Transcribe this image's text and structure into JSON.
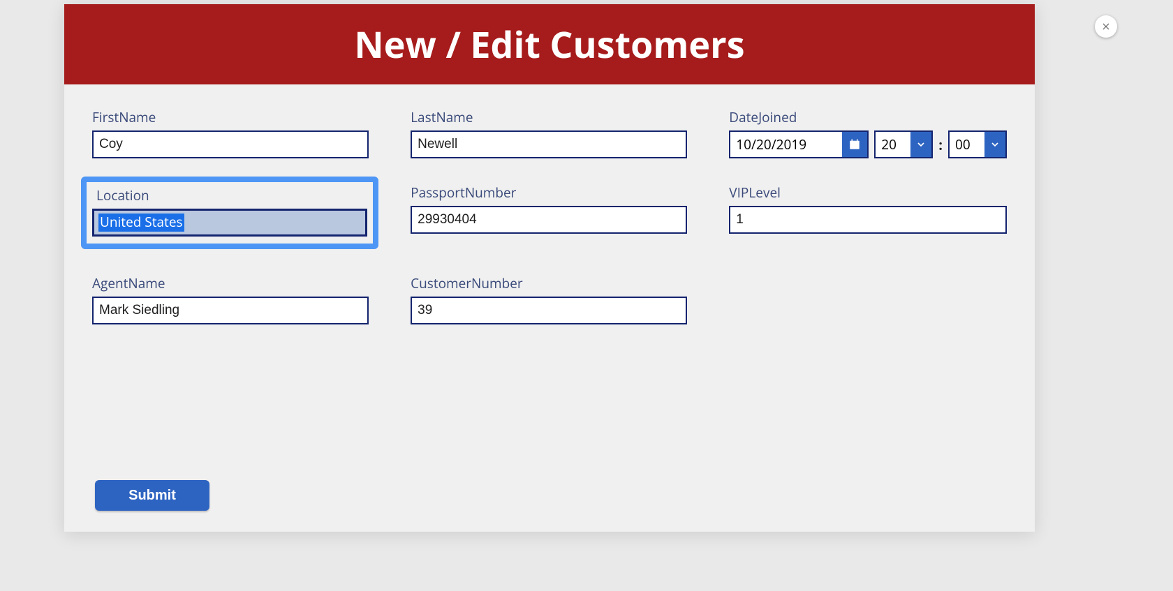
{
  "banner": {
    "title": "New / Edit Customers"
  },
  "fields": {
    "firstName": {
      "label": "FirstName",
      "value": "Coy"
    },
    "lastName": {
      "label": "LastName",
      "value": "Newell"
    },
    "dateJoined": {
      "label": "DateJoined",
      "date": "10/20/2019",
      "hour": "20",
      "minute": "00",
      "sep": ":"
    },
    "location": {
      "label": "Location",
      "value": "United States"
    },
    "passportNumber": {
      "label": "PassportNumber",
      "value": "29930404"
    },
    "vipLevel": {
      "label": "VIPLevel",
      "value": "1"
    },
    "agentName": {
      "label": "AgentName",
      "value": "Mark Siedling"
    },
    "customerNumber": {
      "label": "CustomerNumber",
      "value": "39"
    }
  },
  "buttons": {
    "submit": "Submit"
  }
}
